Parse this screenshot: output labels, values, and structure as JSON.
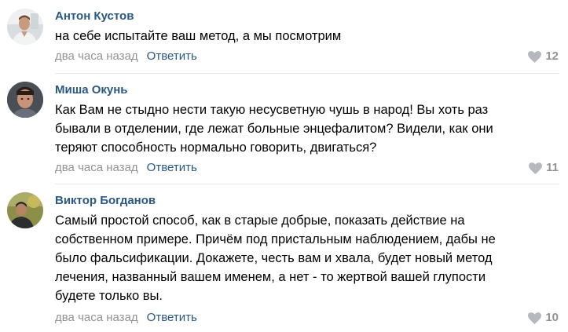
{
  "comments": [
    {
      "author": "Антон Кустов",
      "lines": [
        "на себе испытайте ваш метод, а мы посмотрим"
      ],
      "time": "два часа назад",
      "reply_label": "Ответить",
      "likes": "12"
    },
    {
      "author": "Миша Окунь",
      "lines": [
        "Как Вам не стыдно нести такую несусветную чушь в народ! Вы хоть раз",
        "бывали в отделении, где лежат больные энцефалитом? Видели, как они",
        "теряют способность нормально говорить, двигаться?"
      ],
      "time": "два часа назад",
      "reply_label": "Ответить",
      "likes": "11"
    },
    {
      "author": "Виктор Богданов",
      "lines": [
        "Самый простой способ, как в старые добрые, показать действие на",
        "собственном примере. Причём под пристальным наблюдением, дабы не",
        "было фальсификации. Докажете, честь вам и хвала, будет новый метод",
        "лечения, названный вашем именем, а нет - то жертвой вашей глупости",
        "будете только вы."
      ],
      "time": "два часа назад",
      "reply_label": "Ответить",
      "likes": "10"
    }
  ],
  "colors": {
    "link": "#2a5885",
    "muted": "#939393",
    "divider": "#e7e8ec"
  },
  "icons": {
    "like": "heart-icon"
  }
}
